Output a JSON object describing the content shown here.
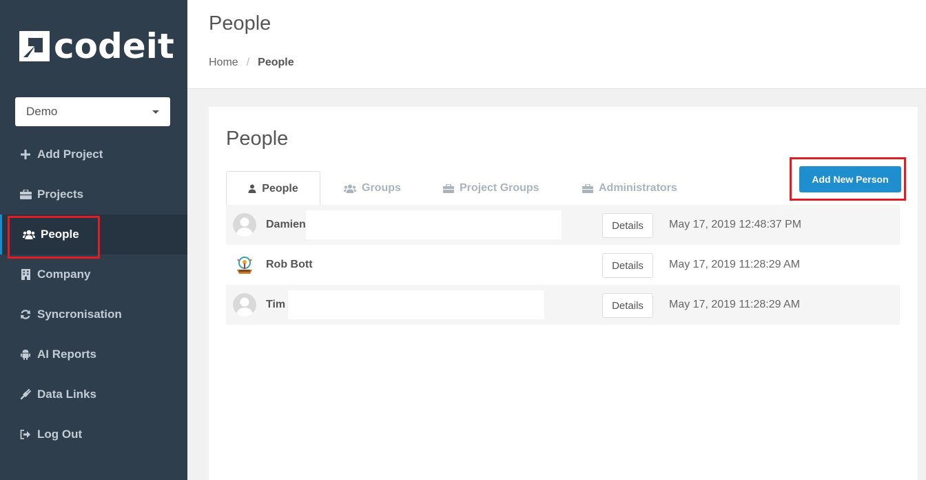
{
  "app": {
    "logo_text": "codeit"
  },
  "project_selector": {
    "value": "Demo"
  },
  "sidebar": {
    "items": [
      {
        "label": "Add Project",
        "icon": "plus-icon"
      },
      {
        "label": "Projects",
        "icon": "briefcase-icon"
      },
      {
        "label": "People",
        "icon": "users-icon",
        "active": true
      },
      {
        "label": "Company",
        "icon": "building-icon"
      },
      {
        "label": "Syncronisation",
        "icon": "refresh-icon"
      },
      {
        "label": "AI Reports",
        "icon": "android-icon"
      },
      {
        "label": "Data Links",
        "icon": "plug-icon"
      },
      {
        "label": "Log Out",
        "icon": "sign-out-icon"
      }
    ]
  },
  "header": {
    "title": "People",
    "breadcrumb": {
      "home": "Home",
      "separator": "/",
      "current": "People"
    }
  },
  "panel": {
    "title": "People",
    "tabs": [
      {
        "label": "People",
        "icon": "user-icon",
        "active": true
      },
      {
        "label": "Groups",
        "icon": "users-icon"
      },
      {
        "label": "Project Groups",
        "icon": "briefcase-icon"
      },
      {
        "label": "Administrators",
        "icon": "briefcase-icon"
      }
    ],
    "add_button": "Add New Person",
    "people": [
      {
        "name": "Damien",
        "details": "Details",
        "date": "May 17, 2019 12:48:37 PM",
        "avatar": "default-avatar"
      },
      {
        "name": "Rob Bott",
        "details": "Details",
        "date": "May 17, 2019 11:28:29 AM",
        "avatar": "robot-avatar"
      },
      {
        "name": "Tim",
        "details": "Details",
        "date": "May 17, 2019 11:28:29 AM",
        "avatar": "default-avatar"
      }
    ]
  },
  "colors": {
    "sidebar_bg": "#2f3e4d",
    "accent": "#1e8ecf",
    "highlight": "#e21c24"
  }
}
